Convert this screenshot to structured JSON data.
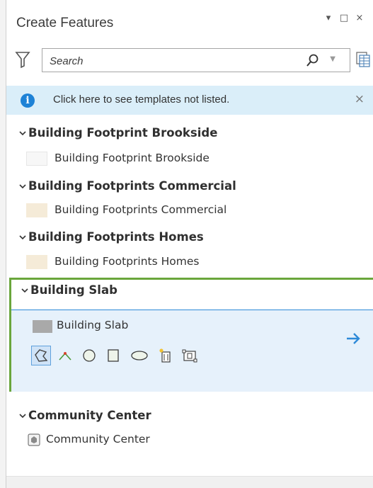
{
  "pane": {
    "title": "Create Features",
    "controls": {
      "dropdown": "▾",
      "maximize": "□",
      "close": "×"
    }
  },
  "search": {
    "placeholder": "Search",
    "value": ""
  },
  "info_bar": {
    "text": "Click here to see templates not listed.",
    "icon": "info-icon",
    "close": "×"
  },
  "groups": [
    {
      "title": "Building Footprint Brookside",
      "template": "Building Footprint Brookside",
      "swatch_color": "#f7f7f7",
      "swatch_border": "#e6e6e6"
    },
    {
      "title": "Building Footprints Commercial",
      "template": "Building Footprints Commercial",
      "swatch_color": "#f5ebd8",
      "swatch_border": "#f5ebd8"
    },
    {
      "title": "Building Footprints Homes",
      "template": "Building Footprints Homes",
      "swatch_color": "#f5ebd8",
      "swatch_border": "#f5ebd8"
    },
    {
      "title": "Building Slab",
      "template": "Building Slab",
      "swatch_color": "#a9a9a9",
      "swatch_border": "#a9a9a9",
      "selected": true,
      "tools": [
        "polygon-tool-icon",
        "right-angle-line-tool-icon",
        "circle-tool-icon",
        "rectangle-tool-icon",
        "ellipse-tool-icon",
        "auto-complete-polygon-tool-icon",
        "footprint-tool-icon"
      ]
    },
    {
      "title": "Community Center",
      "template": "Community Center",
      "swatch_icon": "symbol-swatch-icon"
    }
  ],
  "colors": {
    "accent_green": "#6aa63c",
    "accent_blue": "#2e8ad8",
    "info_bg": "#daeef9",
    "selected_bg": "#e6f1fb"
  }
}
